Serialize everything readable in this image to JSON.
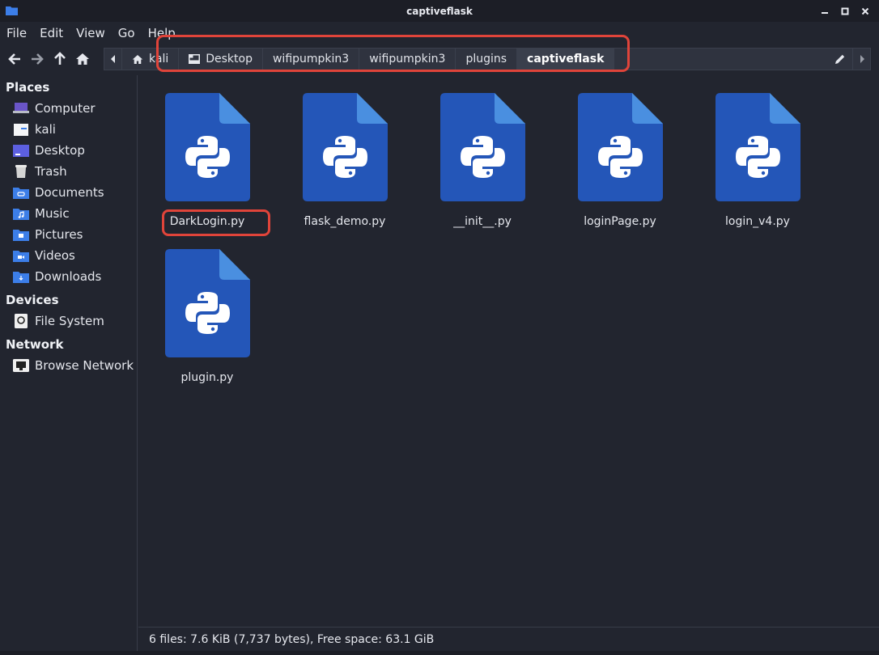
{
  "window": {
    "title": "captiveflask"
  },
  "menubar": {
    "items": [
      "File",
      "Edit",
      "View",
      "Go",
      "Help"
    ]
  },
  "pathbar": {
    "crumbs": [
      {
        "label": "kali",
        "icon": "home-icon"
      },
      {
        "label": "Desktop",
        "icon": "desktop-icon"
      },
      {
        "label": "wifipumpkin3"
      },
      {
        "label": "wifipumpkin3"
      },
      {
        "label": "plugins"
      },
      {
        "label": "captiveflask",
        "active": true
      }
    ]
  },
  "sidebar": {
    "places_header": "Places",
    "places": [
      {
        "label": "Computer",
        "icon": "computer-icon"
      },
      {
        "label": "kali",
        "icon": "home-folder-icon"
      },
      {
        "label": "Desktop",
        "icon": "desktop-icon"
      },
      {
        "label": "Trash",
        "icon": "trash-icon"
      },
      {
        "label": "Documents",
        "icon": "documents-folder-icon"
      },
      {
        "label": "Music",
        "icon": "music-folder-icon"
      },
      {
        "label": "Pictures",
        "icon": "pictures-folder-icon"
      },
      {
        "label": "Videos",
        "icon": "videos-folder-icon"
      },
      {
        "label": "Downloads",
        "icon": "downloads-folder-icon"
      }
    ],
    "devices_header": "Devices",
    "devices": [
      {
        "label": "File System",
        "icon": "drive-icon"
      }
    ],
    "network_header": "Network",
    "network": [
      {
        "label": "Browse Network",
        "icon": "network-icon"
      }
    ]
  },
  "files": [
    {
      "name": "DarkLogin.py",
      "icon": "python-file-icon"
    },
    {
      "name": "flask_demo.py",
      "icon": "python-file-icon"
    },
    {
      "name": "__init__.py",
      "icon": "python-file-icon"
    },
    {
      "name": "loginPage.py",
      "icon": "python-file-icon"
    },
    {
      "name": "login_v4.py",
      "icon": "python-file-icon"
    },
    {
      "name": "plugin.py",
      "icon": "python-file-icon"
    }
  ],
  "status": {
    "text": "6 files: 7.6 KiB (7,737 bytes), Free space: 63.1 GiB"
  },
  "colors": {
    "accent": "#2f6fd6",
    "file_icon": "#2456b8",
    "highlight": "#e0443a"
  }
}
